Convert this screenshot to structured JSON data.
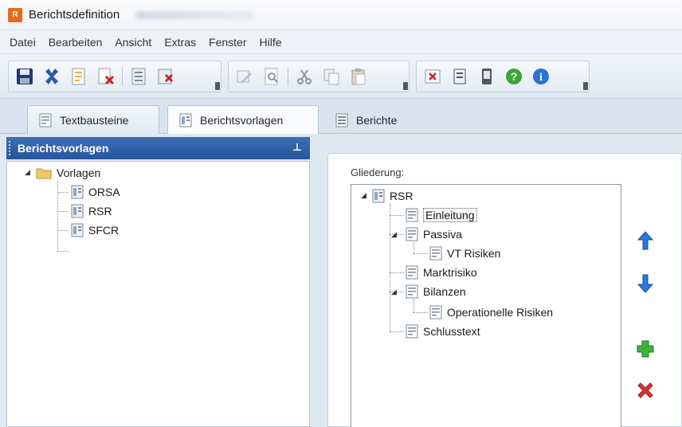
{
  "window": {
    "app_icon_text": "R",
    "title": "Berichtsdefinition"
  },
  "menu": [
    "Datei",
    "Bearbeiten",
    "Ansicht",
    "Extras",
    "Fenster",
    "Hilfe"
  ],
  "toolbar": {
    "group1": [
      "save-icon",
      "delete-icon",
      "new-document-icon",
      "close-document-icon",
      "report-icon",
      "import-icon"
    ],
    "group2": [
      "edit-icon",
      "preview-icon",
      "cut-icon",
      "copy-icon",
      "paste-icon"
    ],
    "group3": [
      "cancel-icon",
      "document-icon",
      "phone-icon",
      "help-icon",
      "info-icon"
    ]
  },
  "tabs": [
    {
      "label": "Textbausteine",
      "icon": "text-block-icon"
    },
    {
      "label": "Berichtsvorlagen",
      "icon": "template-icon"
    },
    {
      "label": "Berichte",
      "icon": "report-icon"
    }
  ],
  "left_panel": {
    "header": "Berichtsvorlagen",
    "pin_glyph": "⊥",
    "tree": {
      "root": "Vorlagen",
      "children": [
        "ORSA",
        "RSR",
        "SFCR"
      ]
    }
  },
  "right_panel": {
    "label": "Gliederung:",
    "tree": {
      "root": "RSR",
      "items": [
        {
          "label": "Einleitung",
          "level": 1,
          "selected": true
        },
        {
          "label": "Passiva",
          "level": 1,
          "expanded": true
        },
        {
          "label": "VT Risiken",
          "level": 2
        },
        {
          "label": "Marktrisiko",
          "level": 1
        },
        {
          "label": "Bilanzen",
          "level": 1,
          "expanded": true
        },
        {
          "label": "Operationelle Risiken",
          "level": 2
        },
        {
          "label": "Schlusstext",
          "level": 1
        }
      ]
    },
    "buttons": [
      "move-up-icon",
      "move-down-icon",
      "add-icon",
      "remove-icon"
    ]
  },
  "colors": {
    "panel_header": "#2f5fa8",
    "tab_strip": "#d9e4f0",
    "app_icon": "#e86a1e"
  }
}
